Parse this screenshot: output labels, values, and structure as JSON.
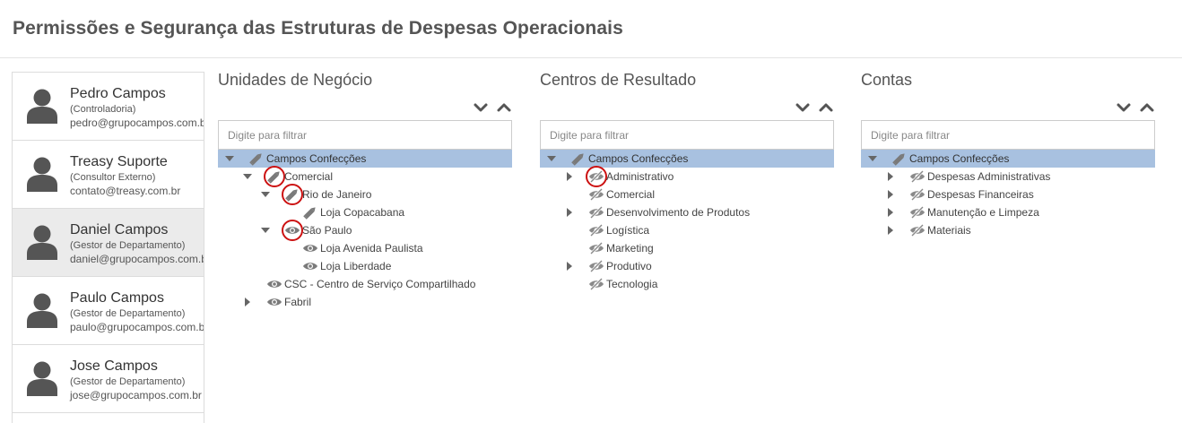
{
  "page": {
    "title": "Permissões e Segurança das Estruturas de Despesas Operacionais"
  },
  "users": [
    {
      "name": "Pedro Campos",
      "role": "(Controladoria)",
      "email": "pedro@grupocampos.com.br",
      "selected": false
    },
    {
      "name": "Treasy Suporte",
      "role": "(Consultor Externo)",
      "email": "contato@treasy.com.br",
      "selected": false
    },
    {
      "name": "Daniel Campos",
      "role": "(Gestor de Departamento)",
      "email": "daniel@grupocampos.com.br",
      "selected": true
    },
    {
      "name": "Paulo Campos",
      "role": "(Gestor de Departamento)",
      "email": "paulo@grupocampos.com.br",
      "selected": false
    },
    {
      "name": "Jose Campos",
      "role": "(Gestor de Departamento)",
      "email": "jose@grupocampos.com.br",
      "selected": false
    }
  ],
  "panels": [
    {
      "id": "unidades",
      "title": "Unidades de Negócio",
      "filter_placeholder": "Digite para filtrar",
      "nodes": [
        {
          "label": "Campos Confecções",
          "level": 0,
          "toggle": "expanded",
          "icon": "pencil-icon",
          "root": true,
          "highlight": false
        },
        {
          "label": "Comercial",
          "level": 1,
          "toggle": "expanded",
          "icon": "pencil-icon",
          "highlight": true
        },
        {
          "label": "Rio de Janeiro",
          "level": 2,
          "toggle": "expanded",
          "icon": "pencil-icon",
          "highlight": true
        },
        {
          "label": "Loja Copacabana",
          "level": 3,
          "toggle": "none",
          "icon": "pencil-icon",
          "highlight": false
        },
        {
          "label": "São Paulo",
          "level": 2,
          "toggle": "expanded",
          "icon": "eye-icon",
          "highlight": true
        },
        {
          "label": "Loja Avenida Paulista",
          "level": 3,
          "toggle": "none",
          "icon": "eye-icon",
          "highlight": false
        },
        {
          "label": "Loja Liberdade",
          "level": 3,
          "toggle": "none",
          "icon": "eye-icon",
          "highlight": false
        },
        {
          "label": "CSC - Centro de Serviço Compartilhado",
          "level": 1,
          "toggle": "none",
          "icon": "eye-icon",
          "highlight": false
        },
        {
          "label": "Fabril",
          "level": 1,
          "toggle": "collapsed",
          "icon": "eye-icon",
          "highlight": false
        }
      ]
    },
    {
      "id": "centros",
      "title": "Centros de Resultado",
      "filter_placeholder": "Digite para filtrar",
      "nodes": [
        {
          "label": "Campos Confecções",
          "level": 0,
          "toggle": "expanded",
          "icon": "pencil-icon",
          "root": true,
          "highlight": false
        },
        {
          "label": "Administrativo",
          "level": 1,
          "toggle": "collapsed",
          "icon": "eye-slash-icon",
          "highlight": true
        },
        {
          "label": "Comercial",
          "level": 1,
          "toggle": "none",
          "icon": "eye-slash-icon",
          "highlight": false
        },
        {
          "label": "Desenvolvimento de Produtos",
          "level": 1,
          "toggle": "collapsed",
          "icon": "eye-slash-icon",
          "highlight": false
        },
        {
          "label": "Logística",
          "level": 1,
          "toggle": "none",
          "icon": "eye-slash-icon",
          "highlight": false
        },
        {
          "label": "Marketing",
          "level": 1,
          "toggle": "none",
          "icon": "eye-slash-icon",
          "highlight": false
        },
        {
          "label": "Produtivo",
          "level": 1,
          "toggle": "collapsed",
          "icon": "eye-slash-icon",
          "highlight": false
        },
        {
          "label": "Tecnologia",
          "level": 1,
          "toggle": "none",
          "icon": "eye-slash-icon",
          "highlight": false
        }
      ]
    },
    {
      "id": "contas",
      "title": "Contas",
      "filter_placeholder": "Digite para filtrar",
      "nodes": [
        {
          "label": "Campos Confecções",
          "level": 0,
          "toggle": "expanded",
          "icon": "pencil-icon",
          "root": true,
          "highlight": false
        },
        {
          "label": "Despesas Administrativas",
          "level": 1,
          "toggle": "collapsed",
          "icon": "eye-slash-icon",
          "highlight": false
        },
        {
          "label": "Despesas Financeiras",
          "level": 1,
          "toggle": "collapsed",
          "icon": "eye-slash-icon",
          "highlight": false
        },
        {
          "label": "Manutenção e Limpeza",
          "level": 1,
          "toggle": "collapsed",
          "icon": "eye-slash-icon",
          "highlight": false
        },
        {
          "label": "Materiais",
          "level": 1,
          "toggle": "collapsed",
          "icon": "eye-slash-icon",
          "highlight": false
        }
      ]
    }
  ],
  "colors": {
    "tree_root_bg": "#a8c1e0",
    "selected_user_bg": "#ebebeb",
    "highlight_ring": "#cc1111",
    "icon_gray": "#6a6a6a"
  }
}
